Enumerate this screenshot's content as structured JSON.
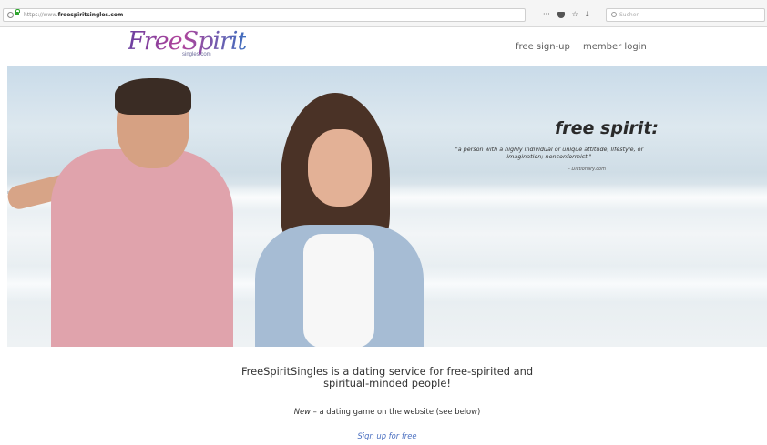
{
  "browser": {
    "url_prefix": "https://www.",
    "url_domain": "freespiritsingles.com",
    "toolbar": {
      "more": "···",
      "star": "☆",
      "download": "⤓"
    },
    "search_placeholder": "Suchen"
  },
  "site": {
    "logo_script": "FreeSpirit",
    "logo_sub": "singles.com",
    "nav": {
      "signup": "free sign-up",
      "login": "member login"
    }
  },
  "hero": {
    "title": "free spirit:",
    "definition": "\"a person with a highly individual or unique attitude, lifestyle, or imagination; nonconformist.\"",
    "source": "– Dictionary.com"
  },
  "intro": {
    "tagline": "FreeSpiritSingles is a dating service for free-spirited and spiritual-minded people!",
    "new_label": "New",
    "new_text": " – a dating game on the website (see below)",
    "signup_link": "Sign up for free"
  },
  "colors": {
    "link": "#4a6fc0",
    "lock": "#2fa52f",
    "logo_gradient": [
      "#6a3fa0",
      "#b1439a",
      "#3f6fbf"
    ]
  },
  "icons": [
    "info-icon",
    "lock-icon",
    "pocket-icon",
    "star-icon",
    "download-icon",
    "search-icon"
  ]
}
